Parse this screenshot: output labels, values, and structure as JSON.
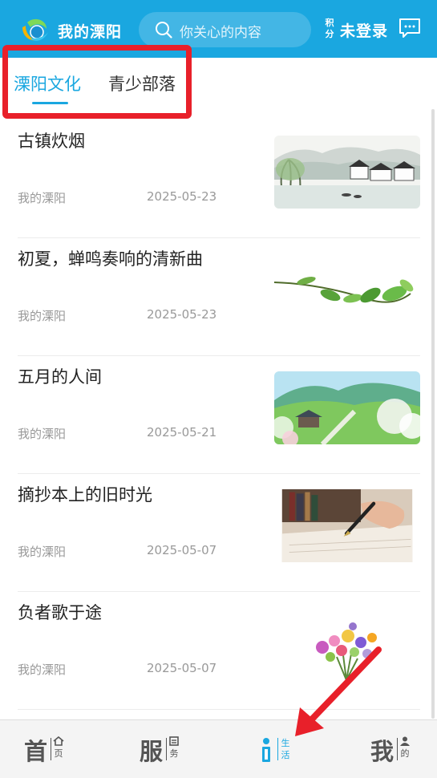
{
  "header": {
    "app_title": "我的溧阳",
    "search_placeholder": "你关心的内容",
    "points_label_top": "积",
    "points_label_bottom": "分",
    "login_label": "未登录"
  },
  "tabs": [
    {
      "label": "溧阳文化",
      "active": true
    },
    {
      "label": "青少部落",
      "active": false
    }
  ],
  "articles": [
    {
      "title": "古镇炊烟",
      "source": "我的溧阳",
      "date": "2025-05-23",
      "thumb_icon": "ink-village-image"
    },
    {
      "title": "初夏，蝉鸣奏响的清新曲",
      "source": "我的溧阳",
      "date": "2025-05-23",
      "thumb_icon": "green-leaf-branch-image"
    },
    {
      "title": "五月的人间",
      "source": "我的溧阳",
      "date": "2025-05-21",
      "thumb_icon": "spring-landscape-image"
    },
    {
      "title": "摘抄本上的旧时光",
      "source": "我的溧阳",
      "date": "2025-05-07",
      "thumb_icon": "pen-writing-image"
    },
    {
      "title": "负者歌于途",
      "source": "我的溧阳",
      "date": "2025-05-07",
      "thumb_icon": "flower-bouquet-image"
    }
  ],
  "bottom_nav": [
    {
      "big": "首",
      "small_top": "",
      "small_bottom": "页",
      "active": false
    },
    {
      "big": "服",
      "small_top": "",
      "small_bottom": "务",
      "active": false
    },
    {
      "big": "",
      "small_top": "生",
      "small_bottom": "活",
      "active": true
    },
    {
      "big": "我",
      "small_top": "",
      "small_bottom": "的",
      "active": false
    }
  ],
  "colors": {
    "brand": "#1aa7e0",
    "highlight": "#e8202a"
  }
}
